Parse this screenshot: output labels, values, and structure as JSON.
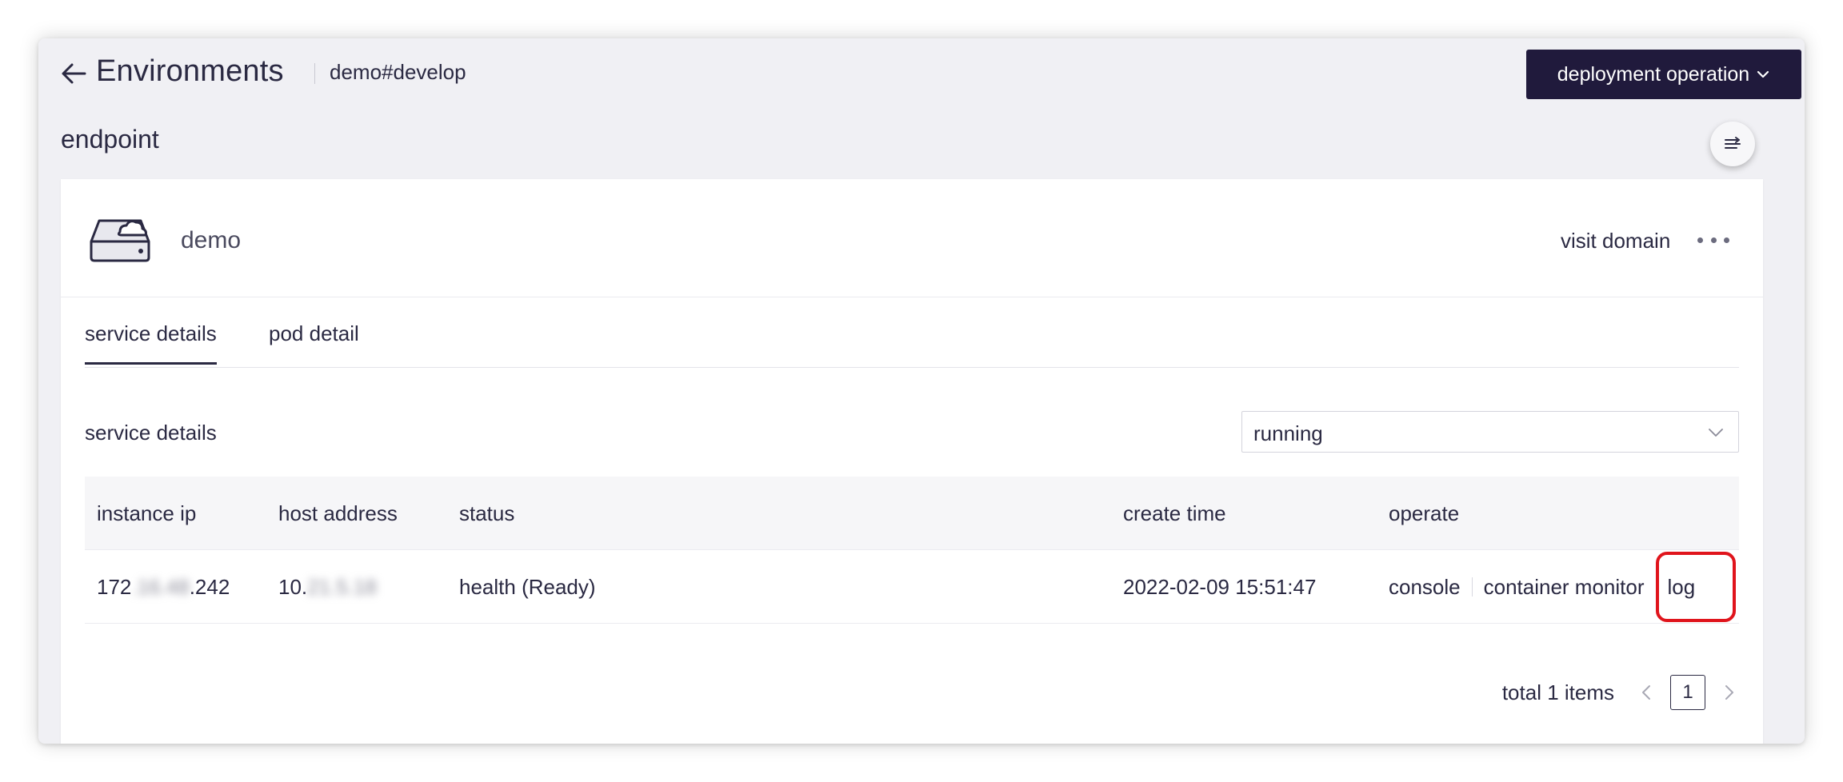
{
  "header": {
    "title": "Environments",
    "breadcrumb": "demo#develop",
    "deploy_button": "deployment operation"
  },
  "section_title": "endpoint",
  "app": {
    "name": "demo",
    "visit_domain": "visit domain"
  },
  "tabs": [
    {
      "label": "service details",
      "active": true
    },
    {
      "label": "pod detail",
      "active": false
    }
  ],
  "service": {
    "title": "service details",
    "status_filter": "running"
  },
  "table": {
    "columns": [
      "instance ip",
      "host address",
      "status",
      "create time",
      "operate"
    ],
    "rows": [
      {
        "instance_ip_prefix": "172",
        "instance_ip_hidden": ".16.48",
        "instance_ip_suffix": ".242",
        "host_address_prefix": "10.",
        "host_address_hidden": "21.5.18",
        "status": "health (Ready)",
        "create_time": "2022-02-09 15:51:47",
        "operations": [
          "console",
          "container monitor",
          "log"
        ]
      }
    ]
  },
  "pagination": {
    "total_text": "total 1 items",
    "current_page": "1"
  },
  "colors": {
    "primary_dark": "#201a3c",
    "highlight": "#e0141c",
    "background": "#f0f0f4"
  },
  "icons": [
    "back-arrow-icon",
    "chevron-down-icon",
    "collapse-icon",
    "cloud-server-icon",
    "more-icon",
    "chevron-left-icon",
    "chevron-right-icon"
  ]
}
